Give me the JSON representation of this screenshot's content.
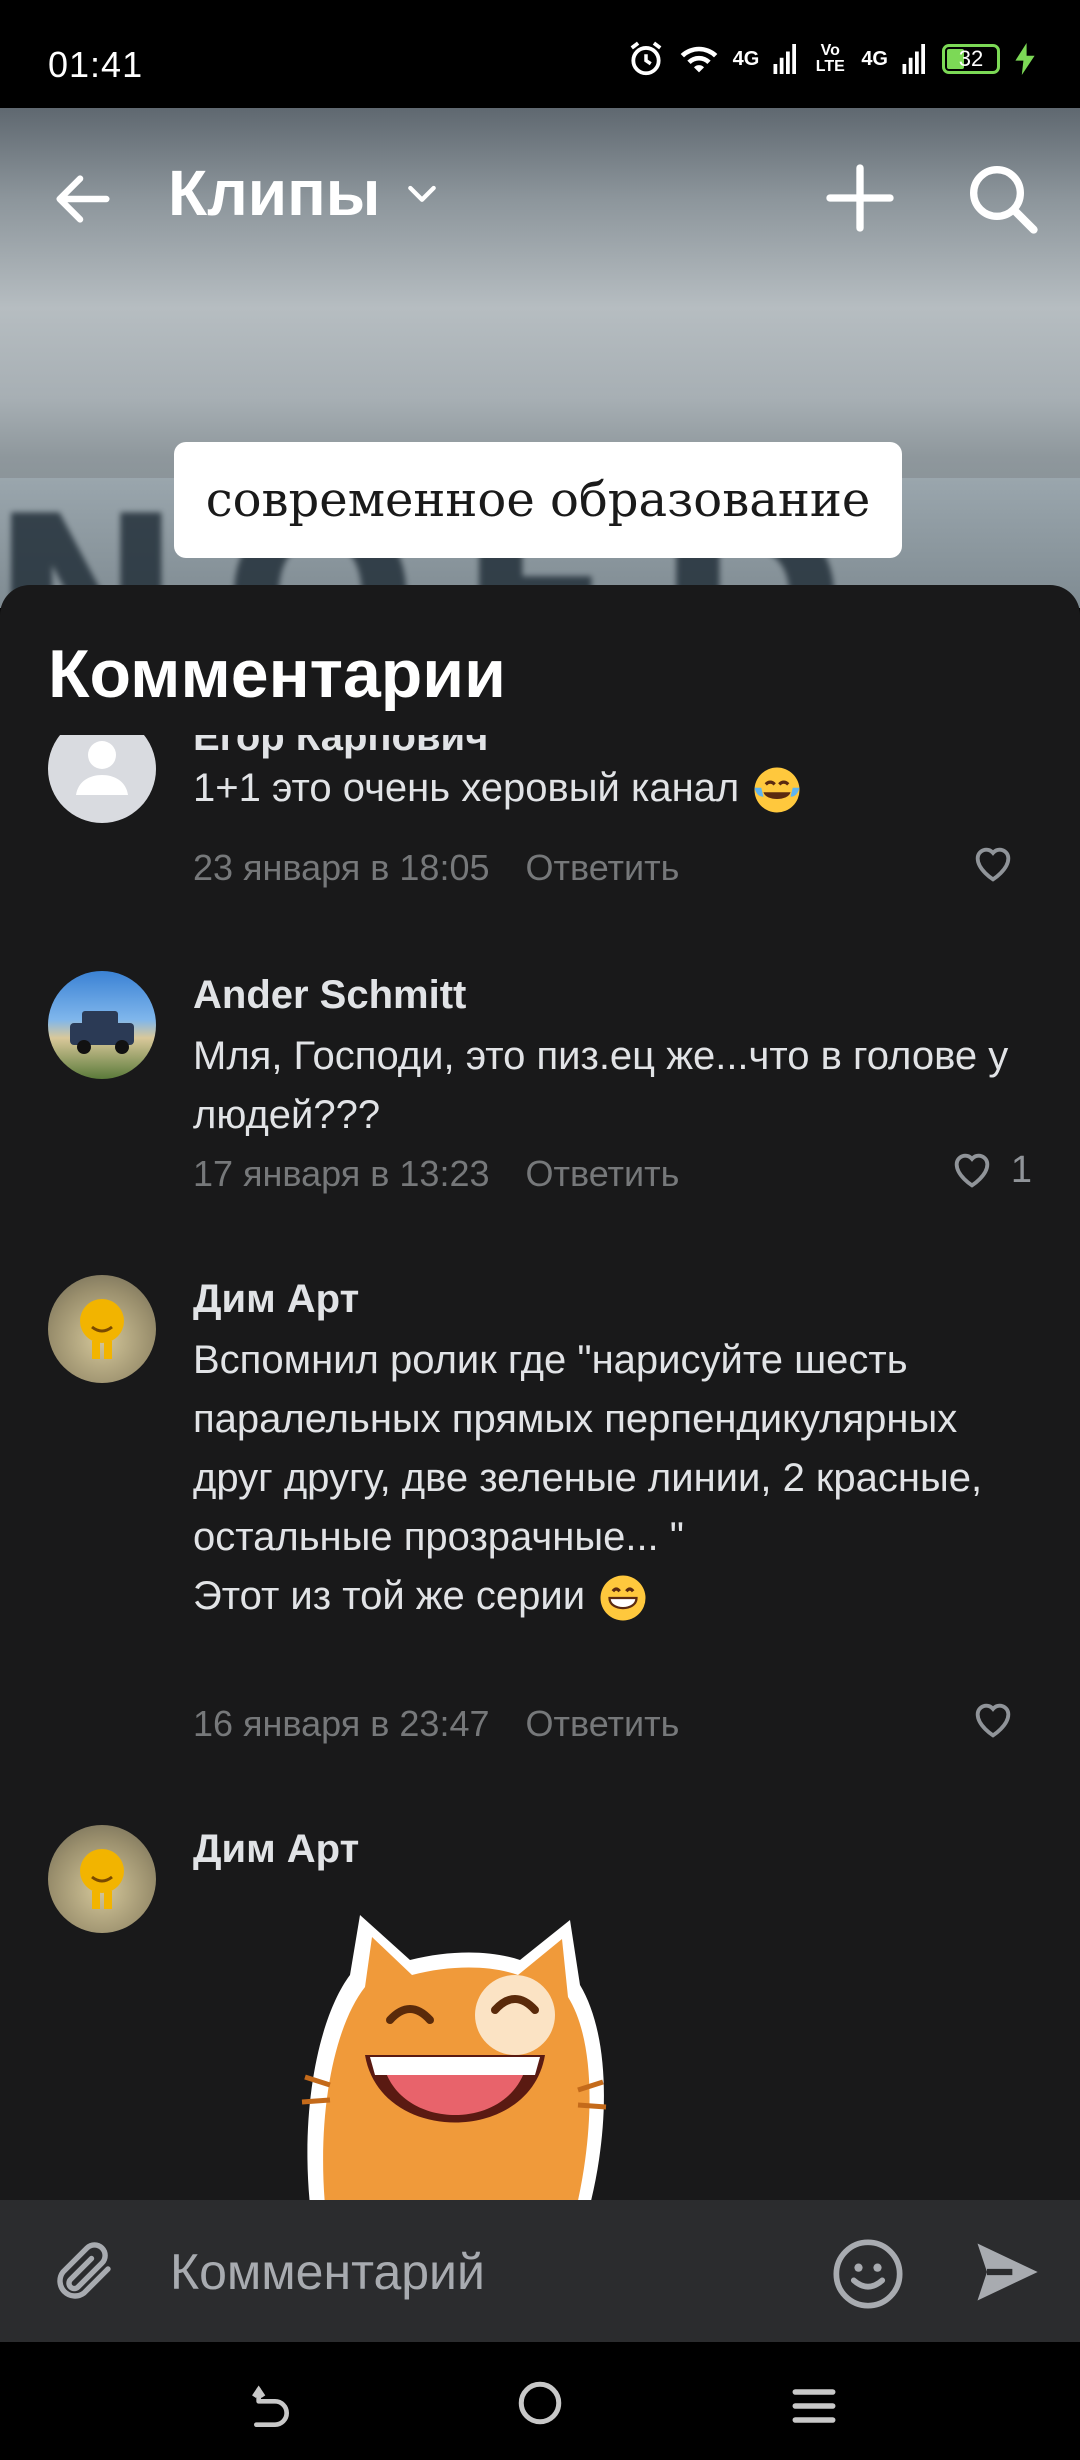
{
  "status_bar": {
    "time": "01:41",
    "network1": "4G",
    "volte": "Vo LTE",
    "network2": "4G",
    "battery": "32"
  },
  "header": {
    "title": "Клипы"
  },
  "video": {
    "caption": "современное образование",
    "background_letters": "NOED"
  },
  "comments_sheet": {
    "title": "Комментарии",
    "comments": [
      {
        "author": "Егор Карпович",
        "text": "1+1 это очень херовый канал",
        "emoji": "tears-of-joy",
        "date": "23 января в 18:05",
        "reply": "Ответить",
        "likes": ""
      },
      {
        "author": "Ander Schmitt",
        "text": "Мля, Господи, это пиз.ец же...что в голове у людей???",
        "date": "17 января в 13:23",
        "reply": "Ответить",
        "likes": "1"
      },
      {
        "author": "Дим Арт",
        "text": "Вспомнил ролик где \"нарисуйте шесть паралельных прямых перпендикулярных друг другу, две зеленые линии, 2 красные, остальные прозрачные... \"",
        "text2": "Этот из той же серии",
        "emoji": "grinning",
        "date": "16 января в 23:47",
        "reply": "Ответить",
        "likes": ""
      },
      {
        "author": "Дим Арт",
        "sticker": "laughing-cat"
      }
    ]
  },
  "input": {
    "placeholder": "Комментарий"
  },
  "colors": {
    "sheet_bg": "#19191a",
    "input_bg": "#2b2c2e",
    "meta": "#76787a",
    "text": "#e1e3e6",
    "battery": "#7cd956"
  }
}
